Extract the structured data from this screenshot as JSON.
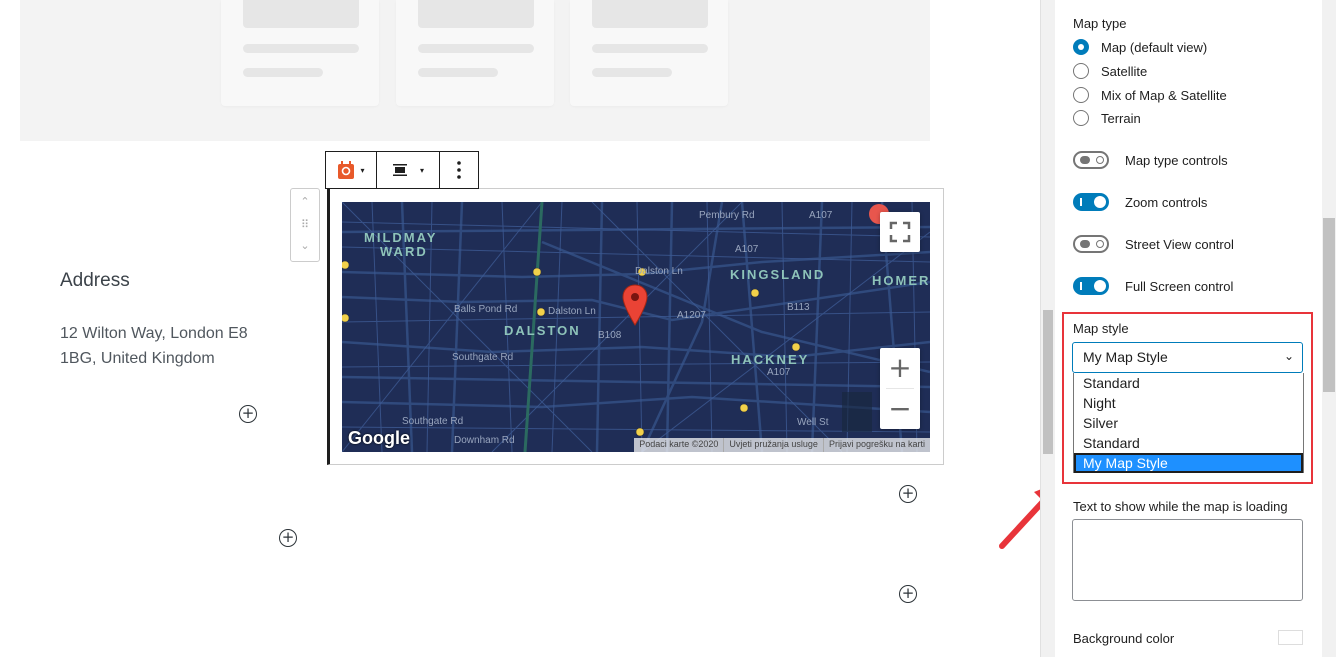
{
  "address": {
    "title": "Address",
    "line1": "12 Wilton Way, London E8",
    "line2": "1BG, United Kingdom"
  },
  "map": {
    "areas": [
      "MILDMAY",
      "WARD",
      "KINGSLAND",
      "HOMER",
      "DALSTON",
      "HACKNEY"
    ],
    "streets": [
      "Balls Pond Rd",
      "Dalston Ln",
      "Dalston Ln",
      "A1207",
      "B113",
      "A107",
      "A107",
      "A107",
      "B108",
      "Southgate Rd",
      "Southgate Rd",
      "Downham Rd",
      "Well St",
      "Pembury Rd"
    ],
    "attribution": [
      "Podaci karte ©2020",
      "Uvjeti pružanja usluge",
      "Prijavi pogrešku na karti"
    ],
    "logo": "Google",
    "colors": {
      "background": "#1f2d56",
      "streets": "#304a7d",
      "labels": "#8ec3b9",
      "marker": "#ea4335",
      "rail": "#2b6a60"
    },
    "icons": [
      "fullscreen-icon",
      "zoom-in-icon",
      "zoom-out-icon",
      "map-marker-icon"
    ],
    "zoom_in": "+",
    "zoom_out": "−"
  },
  "toolbar": {
    "icons": [
      "map-block-icon",
      "align-icon",
      "more-options-icon"
    ],
    "caret": "▾"
  },
  "mover": {
    "up": "⌃",
    "drag": "⠿",
    "down": "⌄"
  },
  "sidebar": {
    "map_type_label": "Map type",
    "map_types": [
      {
        "label": "Map (default view)",
        "checked": true
      },
      {
        "label": "Satellite",
        "checked": false
      },
      {
        "label": "Mix of Map & Satellite",
        "checked": false
      },
      {
        "label": "Terrain",
        "checked": false
      }
    ],
    "toggles": [
      {
        "label": "Map type controls",
        "on": false
      },
      {
        "label": "Zoom controls",
        "on": true
      },
      {
        "label": "Street View control",
        "on": false
      },
      {
        "label": "Full Screen control",
        "on": true
      }
    ],
    "map_style_label": "Map style",
    "map_style_value": "My Map Style",
    "map_style_options": [
      "Standard",
      "Night",
      "Silver",
      "Standard",
      "My Map Style"
    ],
    "loading_text_label": "Text to show while the map is loading",
    "background_color_label": "Background color",
    "accent_color": "#007cba",
    "highlight_color": "#e8343a"
  }
}
